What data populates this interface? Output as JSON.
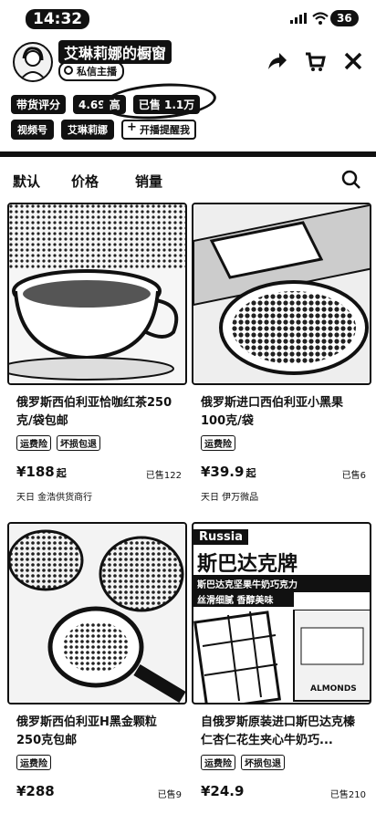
{
  "status_bar": {
    "time": "14:32",
    "battery": "36"
  },
  "shop": {
    "name": "艾琳莉娜的橱窗",
    "dm_label": "私信主播",
    "rating_label": "带货评分",
    "rating_value": "4.69 高",
    "sold_label": "已售 1.1万",
    "channel_label": "视频号",
    "channel_name": "艾琳莉娜",
    "remind_label": "开播提醒我"
  },
  "sort": {
    "default": "默认",
    "price": "价格",
    "sales": "销量"
  },
  "products": [
    {
      "title": "俄罗斯西伯利亚恰咖红茶250克/袋包邮",
      "tags": [
        "运费险",
        "坏损包退"
      ],
      "price": "¥188",
      "price_suffix": "起",
      "sold": "已售122",
      "seller": "天日 金浩供货商行"
    },
    {
      "title": "俄罗斯进口西伯利亚小黑果100克/袋",
      "tags": [
        "运费险"
      ],
      "price": "¥39.9",
      "price_suffix": "起",
      "sold": "已售6",
      "seller": "天日 伊万微品"
    },
    {
      "title": "俄罗斯西伯利亚H黑金颗粒250克包邮",
      "tags": [
        "运费险"
      ],
      "price": "¥288",
      "price_suffix": "",
      "sold": "已售9",
      "seller": ""
    },
    {
      "title": "自俄罗斯原装进口斯巴达克榛仁杏仁花生夹心牛奶巧...",
      "tags": [
        "运费险",
        "坏损包退"
      ],
      "price": "¥24.9",
      "price_suffix": "",
      "sold": "已售210",
      "seller": ""
    }
  ],
  "product_image_text": {
    "brand_en": "Russia",
    "brand_cn": "斯巴达克牌",
    "banner1": "斯巴达克坚果牛奶巧克力",
    "banner2": "丝滑细腻 香醇美味",
    "package": "ALMONDS"
  }
}
